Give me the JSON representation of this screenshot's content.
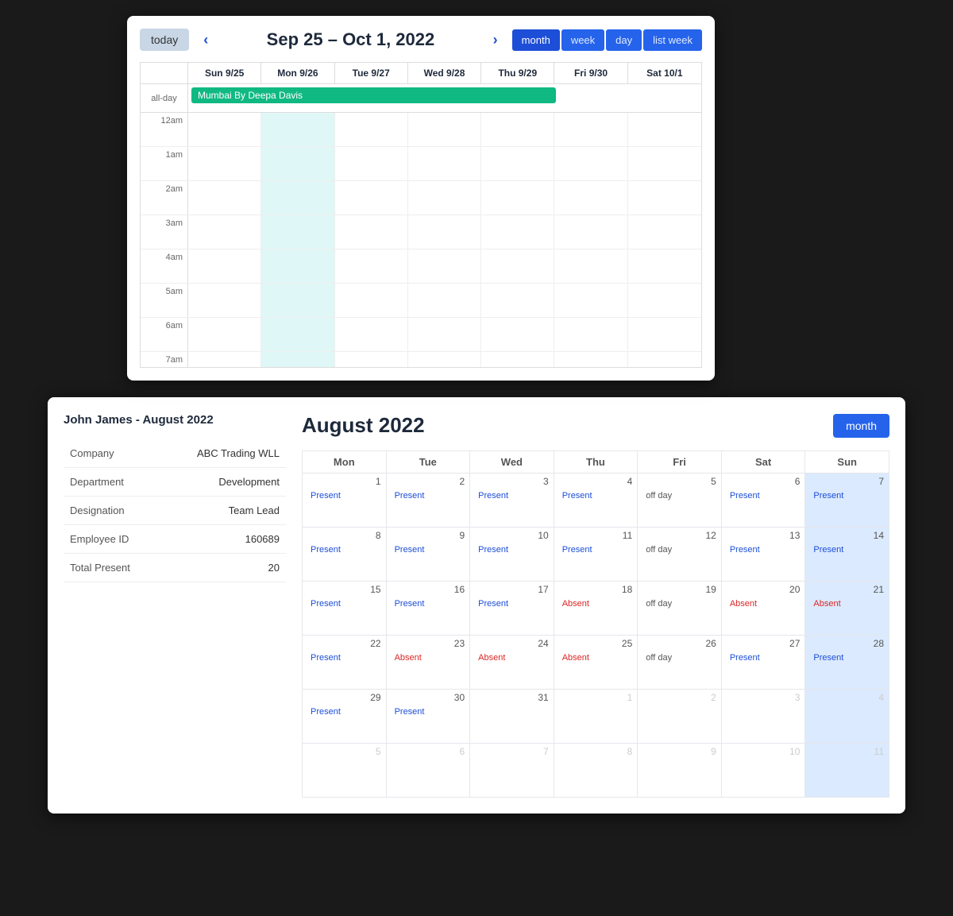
{
  "topPanel": {
    "todayLabel": "today",
    "title": "Sep 25 – Oct 1, 2022",
    "prevArrow": "‹",
    "nextArrow": "›",
    "viewButtons": [
      {
        "label": "month",
        "active": true
      },
      {
        "label": "week",
        "active": false
      },
      {
        "label": "day",
        "active": false
      },
      {
        "label": "list week",
        "active": false
      }
    ],
    "weekDays": [
      {
        "label": "Sun 9/25"
      },
      {
        "label": "Mon 9/26"
      },
      {
        "label": "Tue 9/27"
      },
      {
        "label": "Wed 9/28"
      },
      {
        "label": "Thu 9/29"
      },
      {
        "label": "Fri 9/30"
      },
      {
        "label": "Sat 10/1"
      }
    ],
    "allDayLabel": "all-day",
    "allDayEvent": "Mumbai By Deepa Davis",
    "allDayEventSpan": 5,
    "timeSlots": [
      {
        "label": "12am"
      },
      {
        "label": "1am"
      },
      {
        "label": "2am"
      },
      {
        "label": "3am"
      },
      {
        "label": "4am"
      },
      {
        "label": "5am"
      },
      {
        "label": "6am"
      },
      {
        "label": "7am"
      }
    ]
  },
  "bottomPanel": {
    "employeeTitle": "John James - August 2022",
    "fields": [
      {
        "label": "Company",
        "value": "ABC Trading WLL"
      },
      {
        "label": "Department",
        "value": "Development"
      },
      {
        "label": "Designation",
        "value": "Team Lead"
      },
      {
        "label": "Employee ID",
        "value": "160689"
      },
      {
        "label": "Total Present",
        "value": "20"
      }
    ],
    "monthTitle": "August 2022",
    "monthButtonLabel": "month",
    "weekHeaders": [
      "Mon",
      "Tue",
      "Wed",
      "Thu",
      "Fri",
      "Sat",
      "Sun"
    ],
    "weeks": [
      {
        "days": [
          {
            "num": "1",
            "status": "Present",
            "highlight": false,
            "otherMonth": false
          },
          {
            "num": "2",
            "status": "Present",
            "highlight": false,
            "otherMonth": false
          },
          {
            "num": "3",
            "status": "Present",
            "highlight": false,
            "otherMonth": false
          },
          {
            "num": "4",
            "status": "Present",
            "highlight": false,
            "otherMonth": false
          },
          {
            "num": "5",
            "status": "off day",
            "highlight": false,
            "otherMonth": false
          },
          {
            "num": "6",
            "status": "Present",
            "highlight": false,
            "otherMonth": false
          },
          {
            "num": "7",
            "status": "Present",
            "highlight": true,
            "otherMonth": false
          }
        ]
      },
      {
        "days": [
          {
            "num": "8",
            "status": "Present",
            "highlight": false,
            "otherMonth": false
          },
          {
            "num": "9",
            "status": "Present",
            "highlight": false,
            "otherMonth": false
          },
          {
            "num": "10",
            "status": "Present",
            "highlight": false,
            "otherMonth": false
          },
          {
            "num": "11",
            "status": "Present",
            "highlight": false,
            "otherMonth": false
          },
          {
            "num": "12",
            "status": "off day",
            "highlight": false,
            "otherMonth": false
          },
          {
            "num": "13",
            "status": "Present",
            "highlight": false,
            "otherMonth": false
          },
          {
            "num": "14",
            "status": "Present",
            "highlight": true,
            "otherMonth": false
          }
        ]
      },
      {
        "days": [
          {
            "num": "15",
            "status": "Present",
            "highlight": false,
            "otherMonth": false
          },
          {
            "num": "16",
            "status": "Present",
            "highlight": false,
            "otherMonth": false
          },
          {
            "num": "17",
            "status": "Present",
            "highlight": false,
            "otherMonth": false
          },
          {
            "num": "18",
            "status": "Absent",
            "highlight": false,
            "otherMonth": false
          },
          {
            "num": "19",
            "status": "off day",
            "highlight": false,
            "otherMonth": false
          },
          {
            "num": "20",
            "status": "Absent",
            "highlight": false,
            "otherMonth": false
          },
          {
            "num": "21",
            "status": "Absent",
            "highlight": true,
            "otherMonth": false
          }
        ]
      },
      {
        "days": [
          {
            "num": "22",
            "status": "Present",
            "highlight": false,
            "otherMonth": false
          },
          {
            "num": "23",
            "status": "Absent",
            "highlight": false,
            "otherMonth": false
          },
          {
            "num": "24",
            "status": "Absent",
            "highlight": false,
            "otherMonth": false
          },
          {
            "num": "25",
            "status": "Absent",
            "highlight": false,
            "otherMonth": false
          },
          {
            "num": "26",
            "status": "off day",
            "highlight": false,
            "otherMonth": false
          },
          {
            "num": "27",
            "status": "Present",
            "highlight": false,
            "otherMonth": false
          },
          {
            "num": "28",
            "status": "Present",
            "highlight": true,
            "otherMonth": false
          }
        ]
      },
      {
        "days": [
          {
            "num": "29",
            "status": "Present",
            "highlight": false,
            "otherMonth": false
          },
          {
            "num": "30",
            "status": "Present",
            "highlight": false,
            "otherMonth": false
          },
          {
            "num": "31",
            "status": "",
            "highlight": false,
            "otherMonth": false
          },
          {
            "num": "1",
            "status": "",
            "highlight": false,
            "otherMonth": true
          },
          {
            "num": "2",
            "status": "",
            "highlight": false,
            "otherMonth": true
          },
          {
            "num": "3",
            "status": "",
            "highlight": false,
            "otherMonth": true
          },
          {
            "num": "4",
            "status": "",
            "highlight": true,
            "otherMonth": true
          }
        ]
      },
      {
        "days": [
          {
            "num": "5",
            "status": "",
            "highlight": false,
            "otherMonth": true
          },
          {
            "num": "6",
            "status": "",
            "highlight": false,
            "otherMonth": true
          },
          {
            "num": "7",
            "status": "",
            "highlight": false,
            "otherMonth": true
          },
          {
            "num": "8",
            "status": "",
            "highlight": false,
            "otherMonth": true
          },
          {
            "num": "9",
            "status": "",
            "highlight": false,
            "otherMonth": true
          },
          {
            "num": "10",
            "status": "",
            "highlight": false,
            "otherMonth": true
          },
          {
            "num": "11",
            "status": "",
            "highlight": true,
            "otherMonth": true
          }
        ]
      }
    ]
  }
}
